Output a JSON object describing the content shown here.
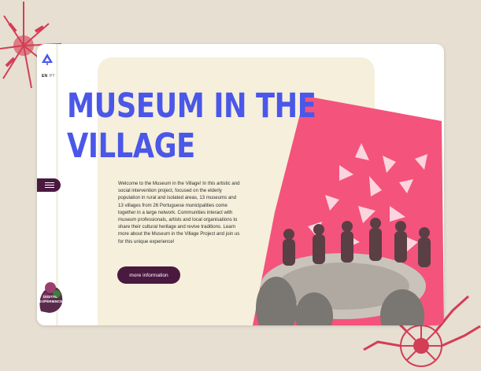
{
  "page": {
    "background": "#e6dfd2",
    "accent_blue": "#4a57e8",
    "accent_pink": "#f4537c",
    "accent_plum": "#4a1940",
    "panel_cream": "#f5efdc"
  },
  "sidebar": {
    "logo_icon": "museum-logo-icon",
    "language": {
      "active": "EN",
      "inactive": "PT"
    },
    "menu_icon": "hamburger-menu-icon",
    "badge": {
      "line1": "DIGITAL",
      "line2": "EXPERIENCE"
    }
  },
  "hero": {
    "title_line1": "MUSEUM IN THE",
    "title_line2": "VILLAGE",
    "intro": "Welcome to the Museum in the Village! In this artistic and social intervention project, focused on the elderly population in rural and isolated areas, 13 museums and 13 villages from 26 Portuguese municipalities come together in a large network. Communities interact with museum professionals, artists and local organisations to share their cultural heritage and revive traditions. Learn more about the Museum in the Village Project and join us for this unique experience!",
    "button_label": "more information"
  }
}
